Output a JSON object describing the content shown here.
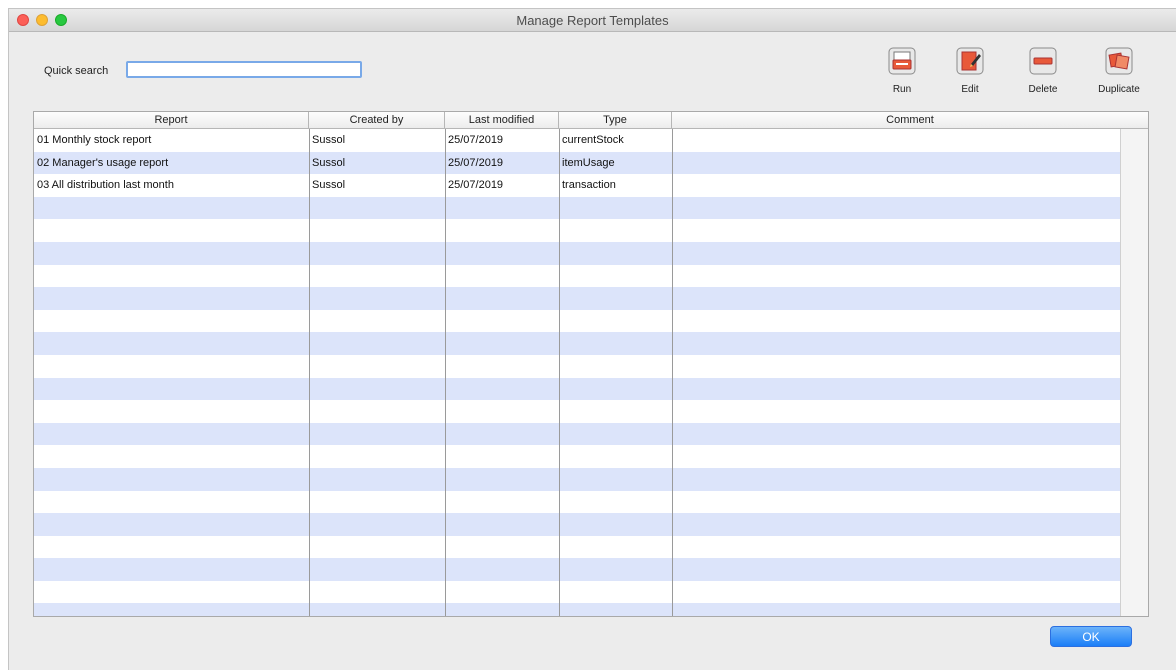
{
  "window": {
    "title": "Manage Report Templates"
  },
  "search": {
    "label": "Quick search",
    "value": "",
    "placeholder": ""
  },
  "toolbar": {
    "buttons": [
      {
        "id": "run",
        "label": "Run",
        "icon": "run-icon"
      },
      {
        "id": "edit",
        "label": "Edit",
        "icon": "edit-icon"
      },
      {
        "id": "delete",
        "label": "Delete",
        "icon": "delete-icon"
      },
      {
        "id": "duplicate",
        "label": "Duplicate",
        "icon": "duplicate-icon"
      }
    ]
  },
  "table": {
    "columns": [
      "Report",
      "Created by",
      "Last modified",
      "Type",
      "Comment"
    ],
    "rows": [
      [
        "01 Monthly stock report",
        "Sussol",
        "25/07/2019",
        "currentStock",
        ""
      ],
      [
        "02 Manager's usage report",
        "Sussol",
        "25/07/2019",
        "itemUsage",
        ""
      ],
      [
        "03 All distribution last month",
        "Sussol",
        "25/07/2019",
        "transaction",
        ""
      ]
    ]
  },
  "footer": {
    "ok_label": "OK"
  },
  "colors": {
    "row_stripe": "#dce4fa",
    "ok_button": "#1b7ef7",
    "close": "#fc5f57",
    "minimize": "#fdbc2e",
    "zoom": "#28c840"
  }
}
